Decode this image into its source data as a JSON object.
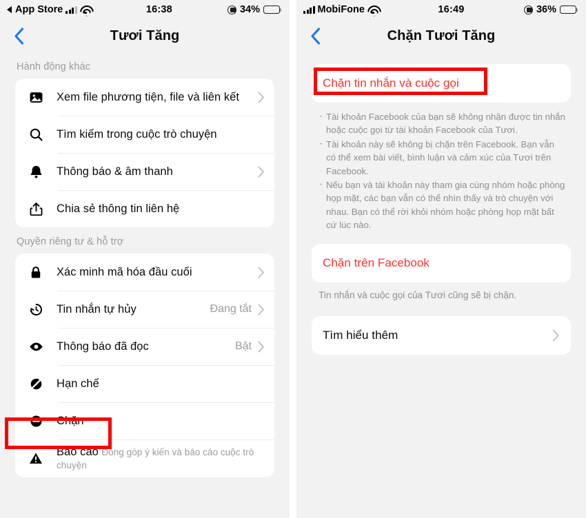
{
  "left": {
    "status": {
      "back_app": "App Store",
      "time": "16:38",
      "battery_pct": "34%"
    },
    "nav": {
      "title": "Tươi Tăng",
      "back": "back-chevron"
    },
    "sections": [
      {
        "title": "Hành động khác",
        "rows": [
          {
            "icon": "photo-icon",
            "label": "Xem file phương tiện, file và liên kết",
            "value": "",
            "sub": "",
            "chevron": true
          },
          {
            "icon": "search-icon",
            "label": "Tìm kiếm trong cuộc trò chuyện",
            "value": "",
            "sub": "",
            "chevron": false
          },
          {
            "icon": "bell-icon",
            "label": "Thông báo & âm thanh",
            "value": "",
            "sub": "",
            "chevron": true
          },
          {
            "icon": "share-icon",
            "label": "Chia sẻ thông tin liên hệ",
            "value": "",
            "sub": "",
            "chevron": false
          }
        ]
      },
      {
        "title": "Quyền riêng tư & hỗ trợ",
        "rows": [
          {
            "icon": "lock-icon",
            "label": "Xác minh mã hóa đầu cuối",
            "value": "",
            "sub": "",
            "chevron": true
          },
          {
            "icon": "clock-history-icon",
            "label": "Tin nhắn tự hủy",
            "value": "Đang tắt",
            "sub": "",
            "chevron": true
          },
          {
            "icon": "eye-icon",
            "label": "Thông báo đã đọc",
            "value": "Bật",
            "sub": "",
            "chevron": true
          },
          {
            "icon": "restrict-icon",
            "label": "Hạn chế",
            "value": "",
            "sub": "",
            "chevron": false
          },
          {
            "icon": "block-icon",
            "label": "Chặn",
            "value": "",
            "sub": "",
            "chevron": false
          },
          {
            "icon": "warning-icon",
            "label": "Báo cáo",
            "value": "",
            "sub": "Đóng góp ý kiến và báo cáo cuộc trò chuyện",
            "chevron": false
          }
        ]
      }
    ]
  },
  "right": {
    "status": {
      "carrier": "MobiFone",
      "time": "16:49",
      "battery_pct": "36%"
    },
    "nav": {
      "title": "Chặn Tươi Tăng",
      "back": "back-chevron"
    },
    "block_messages": {
      "label": "Chặn tin nhắn và cuộc gọi"
    },
    "bullets": [
      "Tài khoản Facebook của bạn sẽ không nhận được tin nhắn hoặc cuộc gọi từ tài khoản Facebook của Tươi.",
      "Tài khoản này sẽ không bị chặn trên Facebook. Bạn vẫn có thể xem bài viết, bình luận và cảm xúc của Tươi trên Facebook.",
      "Nếu bạn và tài khoản này tham gia cùng nhóm hoặc phòng họp mặt, các bạn vẫn có thể nhìn thấy và trò chuyện với nhau. Bạn có thể rời khỏi nhóm hoặc phòng họp mặt bất cứ lúc nào."
    ],
    "block_facebook": {
      "label": "Chặn trên Facebook"
    },
    "block_facebook_note": "Tin nhắn và cuộc gọi của Tươi cũng sẽ bị chặn.",
    "learn_more": {
      "label": "Tìm hiểu thêm"
    }
  },
  "colors": {
    "danger": "#ff2f2c",
    "annotation": "#fb0000",
    "background": "#f2f2f2",
    "card": "#ffffff",
    "accent_blue": "#1877f2",
    "battery_green": "#2fd255"
  }
}
